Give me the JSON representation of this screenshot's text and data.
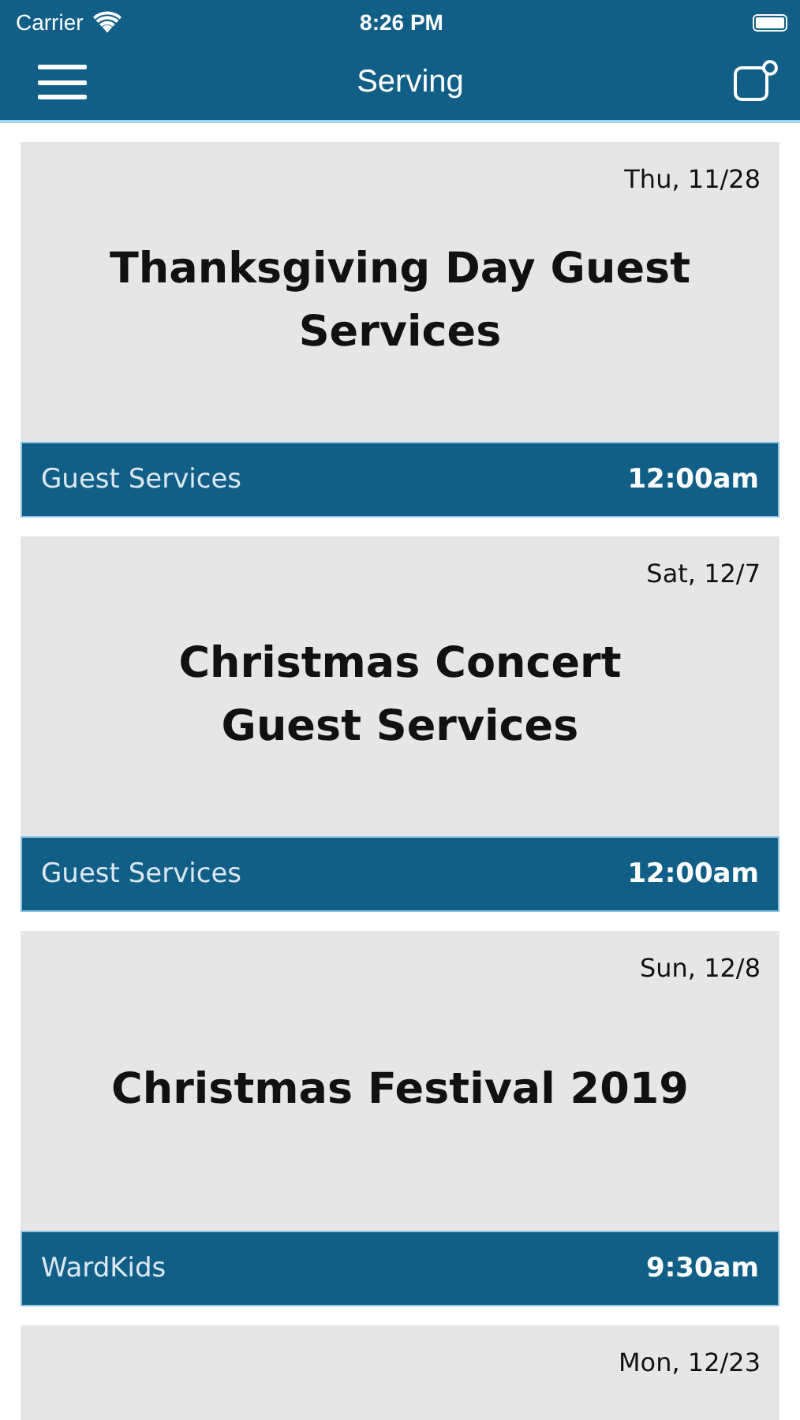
{
  "status_bar": {
    "carrier": "Carrier",
    "time": "8:26 PM"
  },
  "nav": {
    "title": "Serving"
  },
  "events": [
    {
      "date": "Thu, 11/28",
      "title": "Thanksgiving Day Guest Services",
      "team": "Guest Services",
      "time": "12:00am"
    },
    {
      "date": "Sat, 12/7",
      "title": "Christmas Concert Guest Services",
      "team": "Guest Services",
      "time": "12:00am"
    },
    {
      "date": "Sun, 12/8",
      "title": "Christmas Festival 2019",
      "team": "WardKids",
      "time": "9:30am"
    },
    {
      "date": "Mon, 12/23"
    }
  ]
}
